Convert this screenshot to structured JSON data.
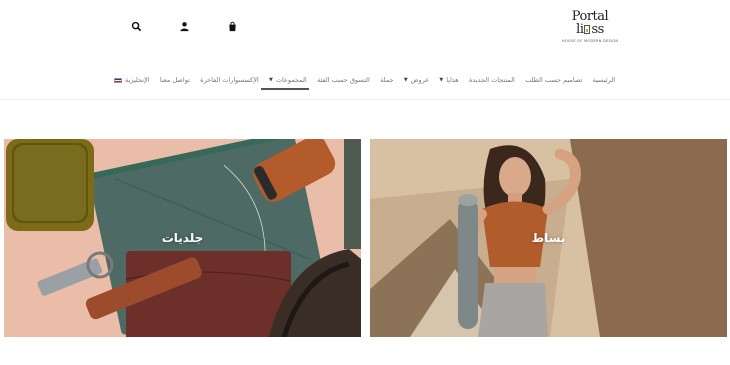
{
  "header": {
    "logo": {
      "word_top": "Portal",
      "word_bottom": "ss",
      "tagline": "HOUSE OF MODERN DESIGN"
    },
    "icons": [
      {
        "name": "search-icon"
      },
      {
        "name": "user-icon"
      },
      {
        "name": "cart-icon"
      }
    ]
  },
  "nav": {
    "items": [
      {
        "label": "الرئيسية",
        "has_caret": false,
        "active": false
      },
      {
        "label": "تصاميم حسب الطلب",
        "has_caret": false,
        "active": false
      },
      {
        "label": "المنتجات الجديدة",
        "has_caret": false,
        "active": false
      },
      {
        "label": "هدايا",
        "has_caret": true,
        "active": false
      },
      {
        "label": "عروض",
        "has_caret": true,
        "active": false
      },
      {
        "label": "جملة",
        "has_caret": false,
        "active": false
      },
      {
        "label": "التسوق حسب الفئة",
        "has_caret": false,
        "active": false
      },
      {
        "label": "المجموعات",
        "has_caret": true,
        "active": true
      },
      {
        "label": "الإكسسوارات الفاخرة",
        "has_caret": false,
        "active": false
      },
      {
        "label": "تواصل معنا",
        "has_caret": false,
        "active": false
      },
      {
        "label": "الإنجليزية",
        "has_caret": false,
        "active": false,
        "flag": true
      }
    ]
  },
  "banners": [
    {
      "title": "جلديات"
    },
    {
      "title": "بساط"
    }
  ]
}
